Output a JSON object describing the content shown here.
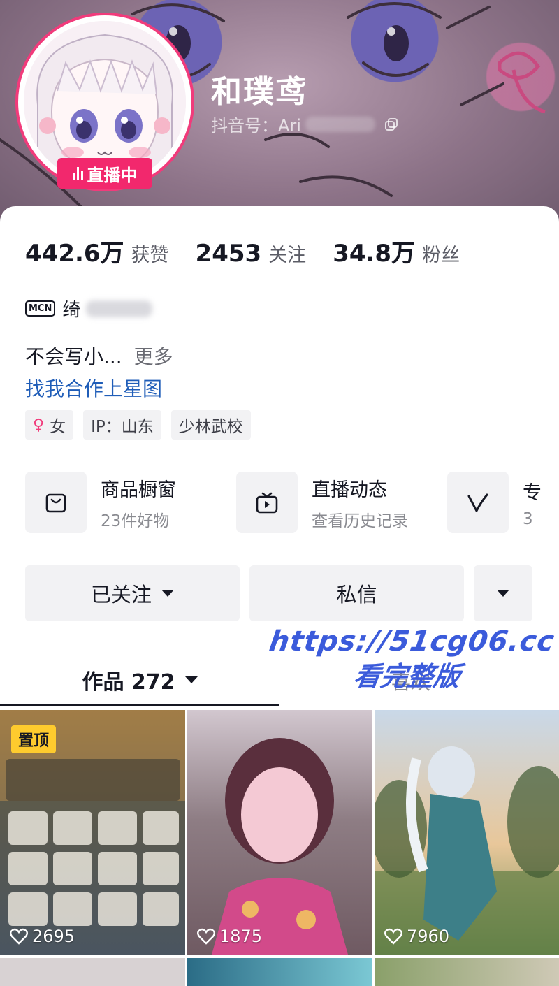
{
  "profile": {
    "nickname": "和璞鸢",
    "douyin_id_label": "抖音号：Ari",
    "live_badge": "直播中"
  },
  "stats": [
    {
      "value": "442.6万",
      "label": "获赞"
    },
    {
      "value": "2453",
      "label": "关注"
    },
    {
      "value": "34.8万",
      "label": "粉丝"
    }
  ],
  "mcn": {
    "logo": "MCN",
    "name": "绮"
  },
  "bio": {
    "text": "不会写小...",
    "more": "更多"
  },
  "star_link": "找我合作上星图",
  "tags": [
    {
      "icon": "female-icon",
      "label": "女"
    },
    {
      "label": "IP：山东"
    },
    {
      "label": "少林武校"
    }
  ],
  "features": [
    {
      "icon": "shopping-bag-icon",
      "title": "商品橱窗",
      "sub": "23件好物"
    },
    {
      "icon": "tv-play-icon",
      "title": "直播动态",
      "sub": "查看历史记录"
    },
    {
      "icon": "v-icon",
      "title": "专",
      "sub": "3"
    }
  ],
  "actions": {
    "followed": "已关注",
    "message": "私信"
  },
  "tabs": {
    "works": "作品 272",
    "likes": "喜欢"
  },
  "watermark": {
    "line1": "https://51cg06.cc",
    "line2": "看完整版"
  },
  "grid": [
    {
      "likes": "2695",
      "pinned": "置顶"
    },
    {
      "likes": "1875"
    },
    {
      "likes": "7960"
    }
  ],
  "colors": {
    "accent": "#f2286d",
    "link": "#1f5db8",
    "watermark": "#3b5bdb"
  }
}
